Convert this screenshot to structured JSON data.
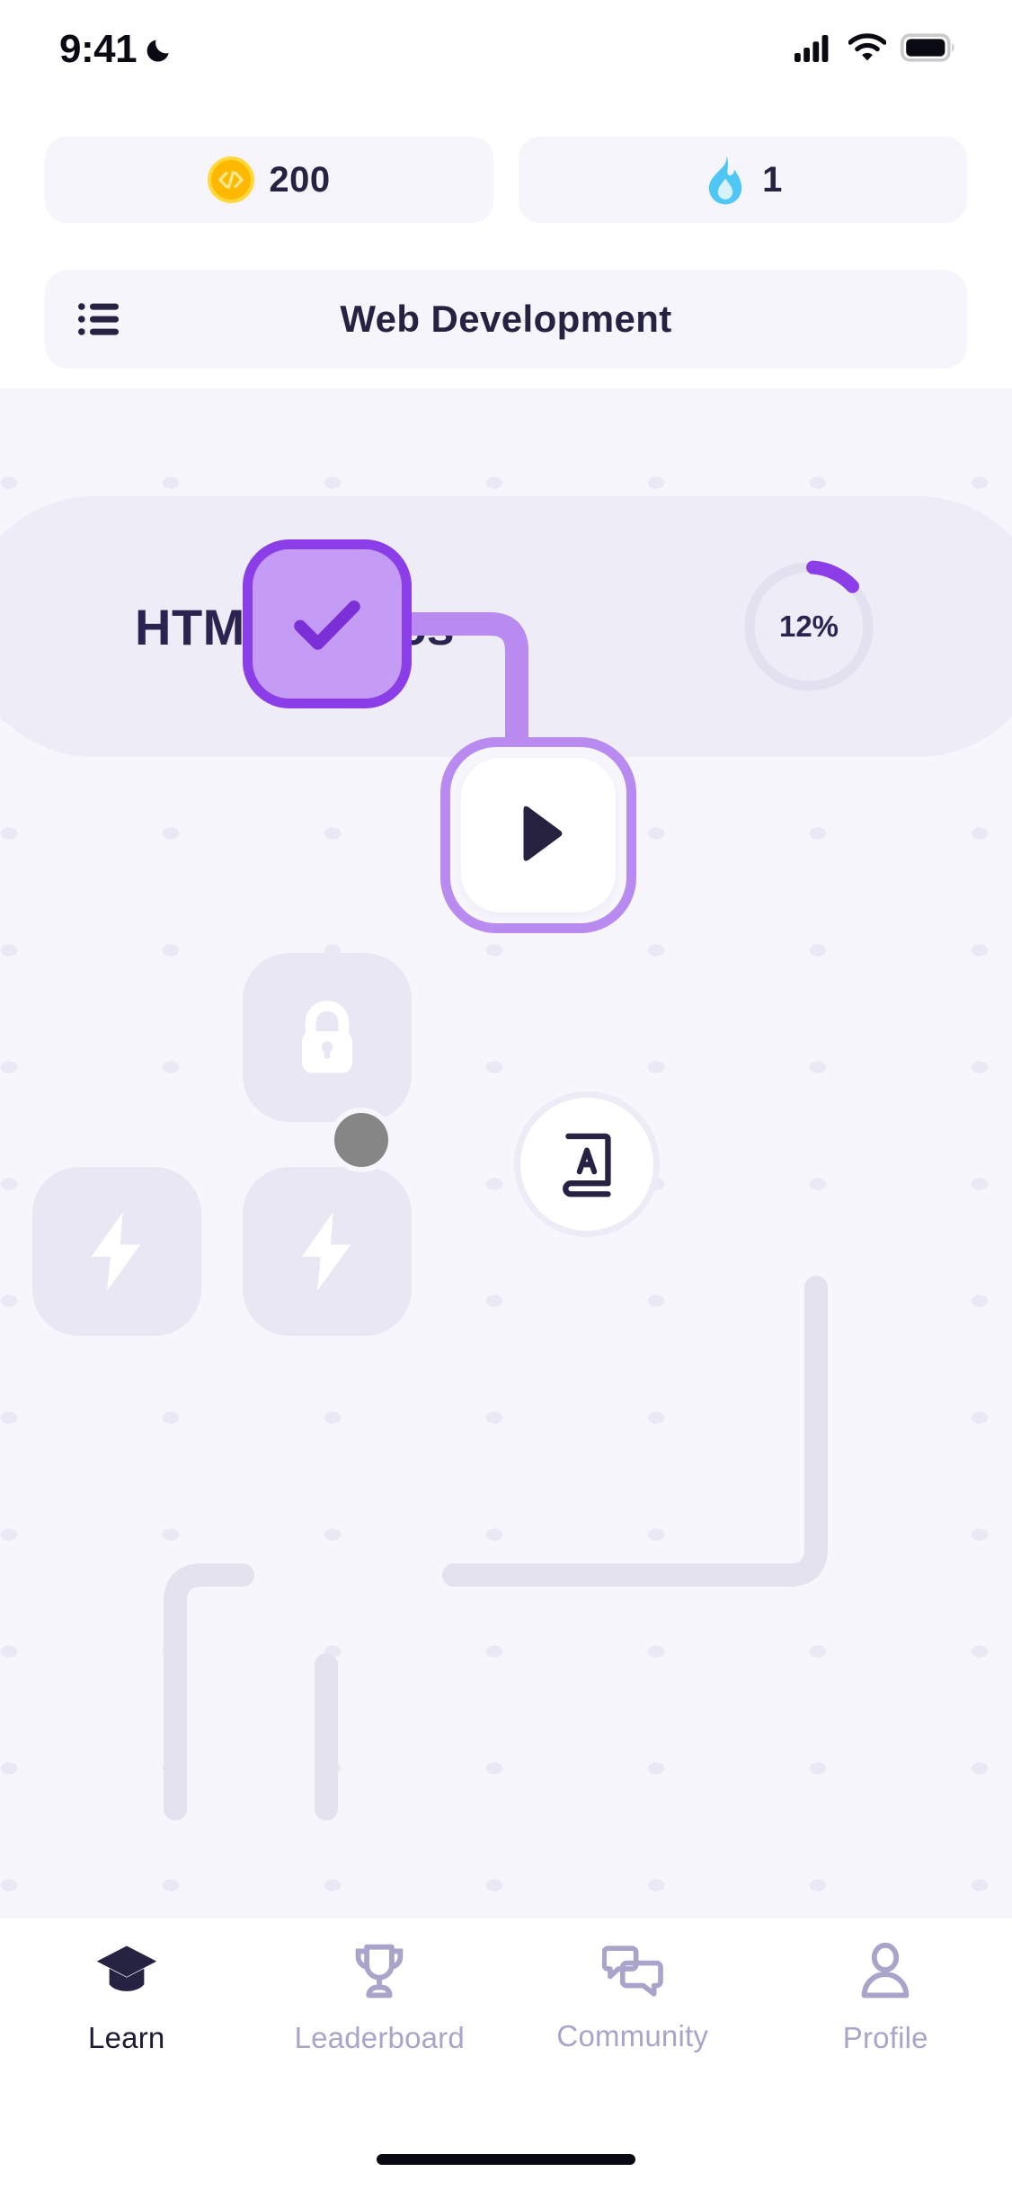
{
  "status_bar": {
    "time": "9:41",
    "moon_icon": "crescent-moon-icon",
    "cellular_icon": "cellular-signal-icon",
    "wifi_icon": "wifi-icon",
    "battery_icon": "battery-full-icon"
  },
  "stats": {
    "coins": {
      "icon": "code-coin-icon",
      "value": "200",
      "color": "#FFB800"
    },
    "streak": {
      "icon": "flame-icon",
      "value": "1",
      "color": "#4FC7F5"
    }
  },
  "header": {
    "menu_icon": "list-menu-icon",
    "title": "Web Development"
  },
  "unit": {
    "title": "HTML Basics",
    "progress_label": "12%",
    "progress_value": 12,
    "ring_color": "#8B3EE8",
    "ring_track_color": "#E3E0F0",
    "banner_color": "#EEECF7"
  },
  "map": {
    "background": "#F7F6FC",
    "dot_color": "#EAE8F5",
    "path_active_color": "#B98BF0",
    "path_locked_color": "#E4E2EF",
    "nodes": [
      {
        "id": "lesson-1",
        "state": "completed",
        "icon": "check-icon",
        "fill": "#C49BF5",
        "border": "#8B3EE8"
      },
      {
        "id": "lesson-2",
        "state": "current",
        "icon": "play-icon",
        "fill": "#FFFFFF",
        "border": "#B98BF0"
      },
      {
        "id": "lesson-3",
        "state": "locked",
        "icon": "lock-icon",
        "fill": "#E9E7F3"
      },
      {
        "id": "lesson-4",
        "state": "locked",
        "icon": "lightning-bolt-icon",
        "fill": "#E9E7F3"
      },
      {
        "id": "lesson-5",
        "state": "locked",
        "icon": "lightning-bolt-icon",
        "fill": "#E9E7F3"
      }
    ],
    "cursor": {
      "icon": "cursor-dot",
      "color": "#868686"
    },
    "dictionary_button": {
      "icon": "dictionary-book-icon",
      "color": "#262241"
    }
  },
  "tabbar": {
    "items": [
      {
        "label": "Learn",
        "icon": "graduation-cap-icon",
        "active": true
      },
      {
        "label": "Leaderboard",
        "icon": "trophy-icon",
        "active": false
      },
      {
        "label": "Community",
        "icon": "chat-bubbles-icon",
        "active": false
      },
      {
        "label": "Profile",
        "icon": "person-icon",
        "active": false
      }
    ],
    "active_color": "#1E1A36",
    "idle_color": "#A9A4CA"
  }
}
